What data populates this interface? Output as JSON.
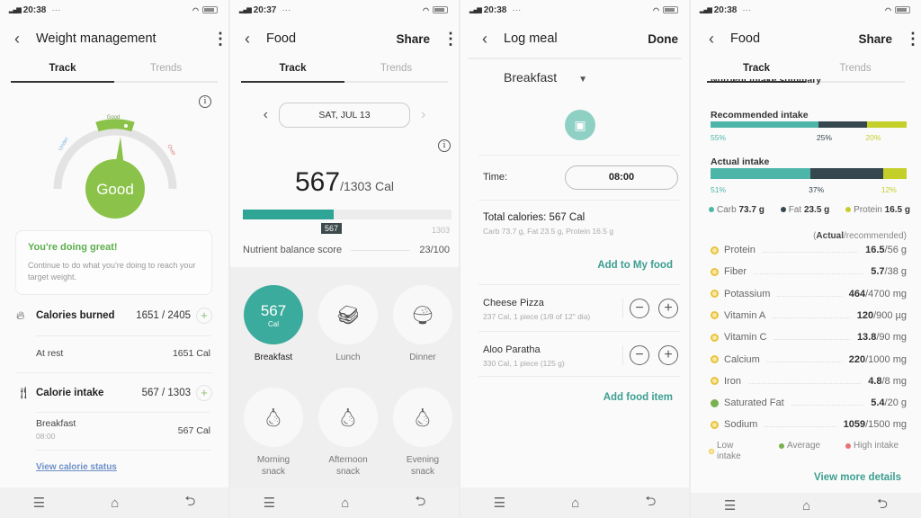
{
  "screens": [
    {
      "status": {
        "time": "20:38",
        "dots": "···"
      },
      "appbar": {
        "title": "Weight management",
        "back_icon": "chevron-left-icon",
        "more_icon": "more-vertical-icon"
      },
      "tabs": [
        {
          "label": "Track",
          "active": true
        },
        {
          "label": "Trends",
          "active": false
        }
      ],
      "gauge": {
        "status": "Good",
        "top_label": "Good",
        "left_label": "Under",
        "right_label": "Over"
      },
      "card": {
        "heading": "You're doing great!",
        "body": "Continue to do what you're doing to reach your target weight."
      },
      "calories_burned": {
        "label": "Calories burned",
        "value": "1651 / 2405",
        "at_rest_label": "At rest",
        "at_rest_value": "1651 Cal"
      },
      "calorie_intake": {
        "label": "Calorie intake",
        "value": "567 / 1303",
        "meal_label": "Breakfast",
        "meal_time": "08:00",
        "meal_value": "567 Cal"
      },
      "link": "View calorie status"
    },
    {
      "status": {
        "time": "20:37",
        "dots": "···"
      },
      "appbar": {
        "title": "Food",
        "action": "Share"
      },
      "tabs": [
        {
          "label": "Track",
          "active": true
        },
        {
          "label": "Trends",
          "active": false
        }
      ],
      "date": "SAT, JUL 13",
      "calories": {
        "consumed": "567",
        "goal": "/1303 Cal",
        "progress": 0.435,
        "tip": "567",
        "max": "1303"
      },
      "nutrient_score": {
        "label": "Nutrient balance score",
        "value": "23/100"
      },
      "meals": [
        {
          "label": "Breakfast",
          "cal": "567",
          "unit": "Cal",
          "active": true,
          "icon": "calories"
        },
        {
          "label": "Lunch",
          "active": false,
          "icon": "sandwich-icon"
        },
        {
          "label": "Dinner",
          "active": false,
          "icon": "bowl-icon"
        },
        {
          "label": "Morning snack",
          "active": false,
          "icon": "fruit-icon"
        },
        {
          "label": "Afternoon snack",
          "active": false,
          "icon": "fruit-icon"
        },
        {
          "label": "Evening snack",
          "active": false,
          "icon": "fruit-icon"
        }
      ]
    },
    {
      "status": {
        "time": "20:38",
        "dots": "···"
      },
      "appbar": {
        "title": "Log meal",
        "action": "Done"
      },
      "meal_select": "Breakfast",
      "time_label": "Time:",
      "time_value": "08:00",
      "total": {
        "label": "Total calories: 567 Cal",
        "detail": "Carb 73.7 g, Fat 23.5 g, Protein 16.5 g"
      },
      "add_to_my_food": "Add to My food",
      "items": [
        {
          "name": "Cheese Pizza",
          "detail": "237 Cal, 1 piece (1/8 of 12\" dia)"
        },
        {
          "name": "Aloo Paratha",
          "detail": "330 Cal, 1 piece (125 g)"
        }
      ],
      "add_food_item": "Add food item"
    },
    {
      "status": {
        "time": "20:38",
        "dots": "···"
      },
      "appbar": {
        "title": "Food",
        "action": "Share"
      },
      "tabs": [
        {
          "label": "Track",
          "active": true
        },
        {
          "label": "Trends",
          "active": false
        }
      ],
      "section_cut": "Nutrient intake summary",
      "recommended": {
        "title": "Recommended intake",
        "carb": 55,
        "fat": 25,
        "protein": 20,
        "carb_label": "55%",
        "fat_label": "25%",
        "protein_label": "20%"
      },
      "actual": {
        "title": "Actual intake",
        "carb": 51,
        "fat": 37,
        "protein": 12,
        "carb_label": "51%",
        "fat_label": "37%",
        "protein_label": "12%"
      },
      "legend": [
        {
          "label": "Carb",
          "value": "73.7 g",
          "color": "#4db6a8"
        },
        {
          "label": "Fat",
          "value": "23.5 g",
          "color": "#37474f"
        },
        {
          "label": "Protein",
          "value": "16.5 g",
          "color": "#c5cf2a"
        }
      ],
      "nutrients_header_bold": "Actual",
      "nutrients_header_rest": "/recommended)",
      "nutrients": [
        {
          "name": "Protein",
          "actual": "16.5",
          "rec": "/56 g",
          "level": "low"
        },
        {
          "name": "Fiber",
          "actual": "5.7",
          "rec": "/38 g",
          "level": "low"
        },
        {
          "name": "Potassium",
          "actual": "464",
          "rec": "/4700 mg",
          "level": "low"
        },
        {
          "name": "Vitamin A",
          "actual": "120",
          "rec": "/900 µg",
          "level": "low"
        },
        {
          "name": "Vitamin C",
          "actual": "13.8",
          "rec": "/90 mg",
          "level": "low"
        },
        {
          "name": "Calcium",
          "actual": "220",
          "rec": "/1000 mg",
          "level": "low"
        },
        {
          "name": "Iron",
          "actual": "4.8",
          "rec": "/8 mg",
          "level": "low"
        },
        {
          "name": "Saturated Fat",
          "actual": "5.4",
          "rec": "/20 g",
          "level": "average"
        },
        {
          "name": "Sodium",
          "actual": "1059",
          "rec": "/1500 mg",
          "level": "low"
        }
      ],
      "intake_legend": {
        "low": "Low intake",
        "average": "Average",
        "high": "High intake"
      },
      "view_more": "View more details"
    }
  ],
  "colors": {
    "teal": "#3aab9c",
    "green": "#8bc34a",
    "dark": "#37474f",
    "lime": "#c5cf2a"
  }
}
